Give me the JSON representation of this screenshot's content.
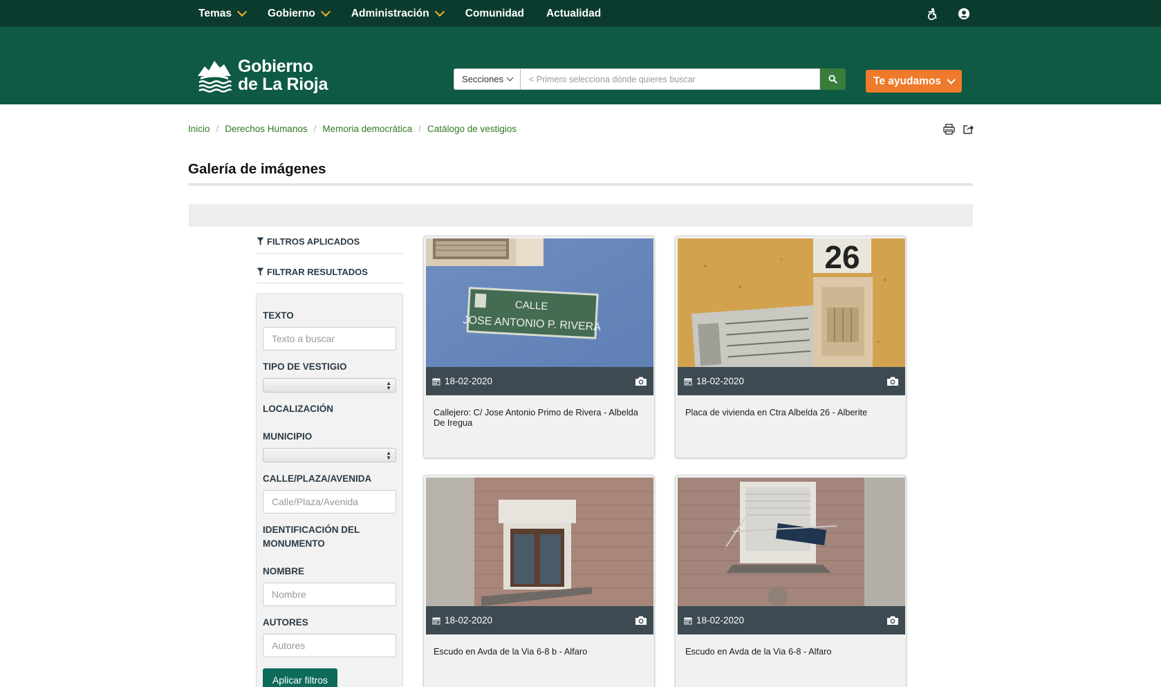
{
  "topnav": {
    "items": [
      {
        "label": "Temas",
        "dropdown": true
      },
      {
        "label": "Gobierno",
        "dropdown": true
      },
      {
        "label": "Administración",
        "dropdown": true
      },
      {
        "label": "Comunidad",
        "dropdown": false
      },
      {
        "label": "Actualidad",
        "dropdown": false
      }
    ],
    "icons": [
      "accessibility-icon",
      "user-icon"
    ]
  },
  "header": {
    "logo_line1": "Gobierno",
    "logo_line2": "de La Rioja",
    "search": {
      "sections_label": "Secciones",
      "placeholder": "< Primero selecciona dónde quieres buscar"
    },
    "help_label": "Te ayudamos"
  },
  "breadcrumb": [
    "Inicio",
    "Derechos Humanos",
    "Memoria democrática",
    "Catálogo de vestigios"
  ],
  "page_title": "Galería de imágenes",
  "sidebar": {
    "applied_filters": "FILTROS APLICADOS",
    "filter_results": "FILTRAR RESULTADOS",
    "texto_label": "TEXTO",
    "texto_placeholder": "Texto a buscar",
    "tipo_label": "TIPO DE VESTIGIO",
    "localizacion_label": "LOCALIZACIÓN",
    "municipio_label": "MUNICIPIO",
    "calle_label": "CALLE/PLAZA/AVENIDA",
    "calle_placeholder": "Calle/Plaza/Avenida",
    "identificacion_label_1": "IDENTIFICACIÓN DEL",
    "identificacion_label_2": "MONUMENTO",
    "nombre_label": "NOMBRE",
    "nombre_placeholder": "Nombre",
    "autores_label": "AUTORES",
    "autores_placeholder": "Autores",
    "apply_label": "Aplicar filtros"
  },
  "gallery": [
    {
      "date": "18-02-2020",
      "caption": "Callejero: C/ Jose Antonio Primo de Rivera - Albelda De Iregua",
      "sign_line1": "CALLE",
      "sign_line2": "JOSE ANTONIO P. RIVERA"
    },
    {
      "date": "18-02-2020",
      "caption": "Placa de vivienda en Ctra Albelda 26 - Alberite",
      "house_number": "26"
    },
    {
      "date": "18-02-2020",
      "caption": "Escudo en Avda de la Via 6-8 b - Alfaro"
    },
    {
      "date": "18-02-2020",
      "caption": "Escudo en Avda de la Via 6-8 - Alfaro"
    }
  ],
  "colors": {
    "topnav_bg": "#0b3b2e",
    "header_bg": "#0e5a45",
    "accent_orange": "#ee7a2b",
    "chevron_yellow": "#f0b429",
    "link_green": "#2f7a1f",
    "card_bar": "#3d4a52",
    "apply_button": "#0e6b5c"
  }
}
